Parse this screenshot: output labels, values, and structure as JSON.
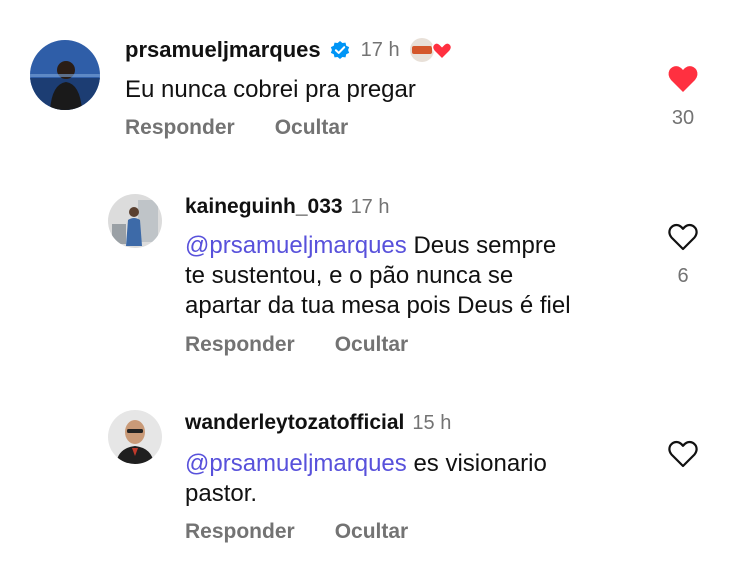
{
  "comments": [
    {
      "username": "prsamueljmarques",
      "time": "17 h",
      "verified": true,
      "creator_liked": true,
      "mention": "",
      "text": "Eu nunca cobrei pra pregar",
      "reply_label": "Responder",
      "hide_label": "Ocultar",
      "liked": true,
      "like_count": "30",
      "like_icon": "heart-filled-icon"
    },
    {
      "username": "kaineguinh_033",
      "time": "17 h",
      "mention": "@prsamueljmarques",
      "text_line1": " Deus sempre",
      "text_line2": "te sustentou, e o pão nunca se",
      "text_line3": "apartar da tua mesa pois Deus é fiel",
      "reply_label": "Responder",
      "hide_label": "Ocultar",
      "liked": false,
      "like_count": "6",
      "like_icon": "heart-outline-icon"
    },
    {
      "username": "wanderleytozatofficial",
      "time": "15 h",
      "mention": "@prsamueljmarques",
      "text_line1": " es visionario",
      "text_line2": "pastor.",
      "reply_label": "Responder",
      "hide_label": "Ocultar",
      "liked": false,
      "like_count": "",
      "like_icon": "heart-outline-icon"
    }
  ],
  "colors": {
    "like_red": "#ff3040",
    "mention": "#5851db",
    "secondary": "#737373",
    "verified_blue": "#0095f6"
  }
}
